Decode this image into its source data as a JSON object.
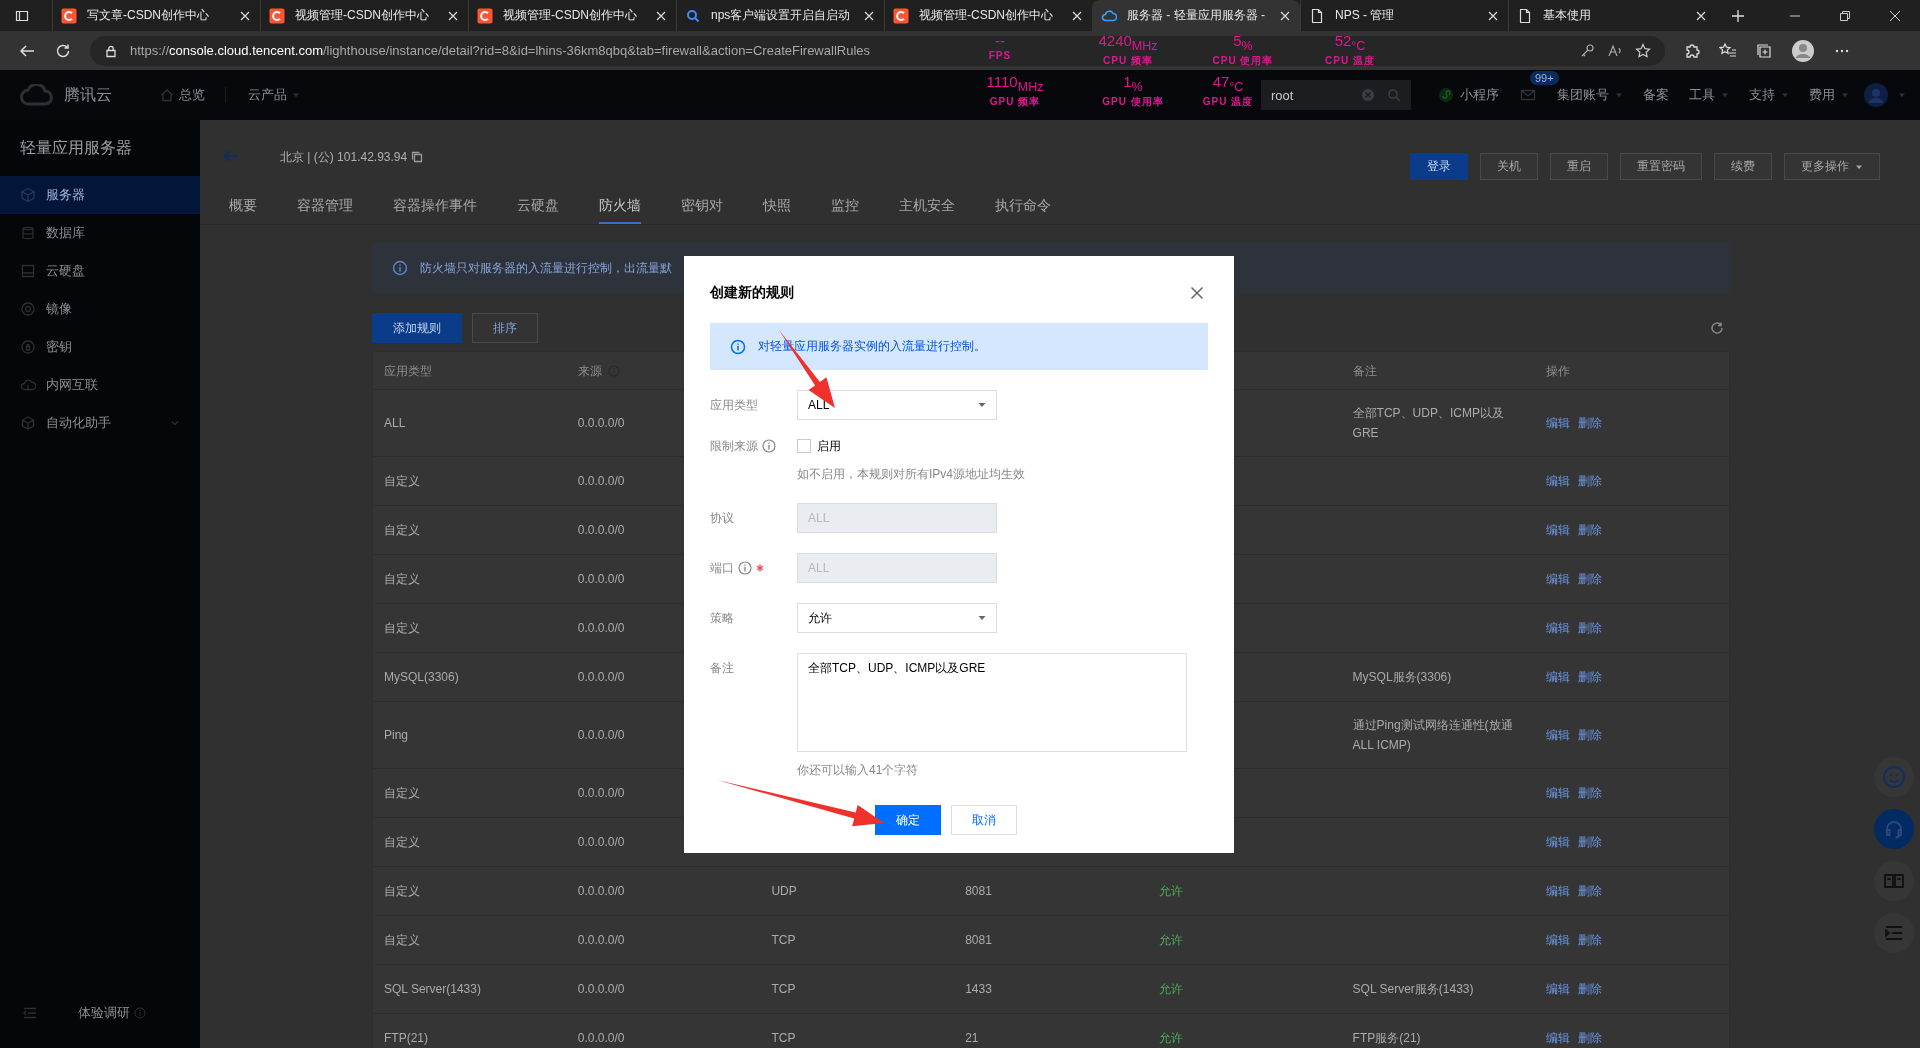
{
  "browser": {
    "tabs": [
      {
        "title": "写文章-CSDN创作中心",
        "kind": "site",
        "selected": false
      },
      {
        "title": "视频管理-CSDN创作中心",
        "kind": "site",
        "selected": false
      },
      {
        "title": "视频管理-CSDN创作中心",
        "kind": "site",
        "selected": false
      },
      {
        "title": "nps客户端设置开启自启动",
        "kind": "search",
        "selected": false
      },
      {
        "title": "视频管理-CSDN创作中心",
        "kind": "site",
        "selected": false
      },
      {
        "title": "服务器 - 轻量应用服务器 -",
        "kind": "cloud",
        "selected": true
      },
      {
        "title": "NPS - 管理",
        "kind": "page",
        "selected": false
      },
      {
        "title": "基本使用",
        "kind": "page",
        "selected": false
      }
    ],
    "address": {
      "scheme": "https://",
      "host": "console.cloud.tencent.com",
      "path": "/lighthouse/instance/detail?rid=8&id=lhins-36km8qbq&tab=firewall&action=CreateFirewallRules"
    }
  },
  "hardware_monitor": [
    {
      "value": "--",
      "label": "FPS"
    },
    {
      "value": "4240$_{MHz}$",
      "label": "CPU 频率"
    },
    {
      "value": "5$_{%}$",
      "label": "CPU 使用率"
    },
    {
      "value": "52$_{°C}$",
      "label": "CPU 温度"
    },
    {
      "value": "1110$_{MHz}$",
      "label": "GPU 频率"
    },
    {
      "value": "1$_{%}$",
      "label": "GPU 使用率"
    },
    {
      "value": "47$_{°C}$",
      "label": "GPU 温度"
    }
  ],
  "header": {
    "brand": "腾讯云",
    "nav": [
      {
        "label": "总览",
        "dropdown": false
      },
      {
        "label": "云产品",
        "dropdown": true
      }
    ],
    "search": {
      "value": "root"
    },
    "mail_badge": "99+",
    "links": [
      {
        "label": "小程序",
        "dropdown": false
      },
      {
        "label": "集团账号",
        "dropdown": true
      },
      {
        "label": "备案",
        "dropdown": false
      },
      {
        "label": "工具",
        "dropdown": true
      },
      {
        "label": "支持",
        "dropdown": true
      },
      {
        "label": "费用",
        "dropdown": true
      }
    ]
  },
  "sidebar": {
    "title": "轻量应用服务器",
    "items": [
      {
        "label": "服务器",
        "selected": true
      },
      {
        "label": "数据库",
        "selected": false
      },
      {
        "label": "云硬盘",
        "selected": false
      },
      {
        "label": "镜像",
        "selected": false
      },
      {
        "label": "密钥",
        "selected": false
      },
      {
        "label": "内网互联",
        "selected": false
      },
      {
        "label": "自动化助手",
        "selected": false,
        "expanded": false
      }
    ],
    "footer": "体验调研"
  },
  "instance": {
    "location": "北京 | (公) 101.42.93.94",
    "actions": [
      {
        "label": "登录",
        "primary": true,
        "dropdown": false
      },
      {
        "label": "关机",
        "primary": false,
        "dropdown": false
      },
      {
        "label": "重启",
        "primary": false,
        "dropdown": false
      },
      {
        "label": "重置密码",
        "primary": false,
        "dropdown": false
      },
      {
        "label": "续费",
        "primary": false,
        "dropdown": false
      },
      {
        "label": "更多操作",
        "primary": false,
        "dropdown": true
      }
    ],
    "tabs": [
      {
        "label": "概要",
        "selected": false
      },
      {
        "label": "容器管理",
        "selected": false
      },
      {
        "label": "容器操作事件",
        "selected": false
      },
      {
        "label": "云硬盘",
        "selected": false
      },
      {
        "label": "防火墙",
        "selected": true
      },
      {
        "label": "密钥对",
        "selected": false
      },
      {
        "label": "快照",
        "selected": false
      },
      {
        "label": "监控",
        "selected": false
      },
      {
        "label": "主机安全",
        "selected": false
      },
      {
        "label": "执行命令",
        "selected": false
      }
    ]
  },
  "firewall": {
    "notice": "防火墙只对服务器的入流量进行控制，出流量默",
    "toolbar": [
      {
        "label": "添加规则",
        "primary": true
      },
      {
        "label": "排序",
        "primary": false
      }
    ],
    "table": {
      "columns": {
        "type": "应用类型",
        "source": "来源",
        "note": "备注",
        "actions": "操作"
      },
      "rows": [
        {
          "type": "ALL",
          "source": "0.0.0.0/0",
          "note": "全部TCP、UDP、ICMP以及GRE",
          "actions": [
            "编辑",
            "删除"
          ]
        },
        {
          "type": "自定义",
          "source": "0.0.0.0/0",
          "actions": [
            "编辑",
            "删除"
          ]
        },
        {
          "type": "自定义",
          "source": "0.0.0.0/0",
          "actions": [
            "编辑",
            "删除"
          ]
        },
        {
          "type": "自定义",
          "source": "0.0.0.0/0",
          "actions": [
            "编辑",
            "删除"
          ]
        },
        {
          "type": "自定义",
          "source": "0.0.0.0/0",
          "actions": [
            "编辑",
            "删除"
          ]
        },
        {
          "type": "MySQL(3306)",
          "source": "0.0.0.0/0",
          "note": "MySQL服务(3306)",
          "actions": [
            "编辑",
            "删除"
          ]
        },
        {
          "type": "Ping",
          "source": "0.0.0.0/0",
          "note": "通过Ping测试网络连通性(放通ALL ICMP)",
          "actions": [
            "编辑",
            "删除"
          ]
        },
        {
          "type": "自定义",
          "source": "0.0.0.0/0",
          "actions": [
            "编辑",
            "删除"
          ]
        },
        {
          "type": "自定义",
          "source": "0.0.0.0/0",
          "actions": [
            "编辑",
            "删除"
          ]
        },
        {
          "type": "自定义",
          "source": "0.0.0.0/0",
          "protocol": "UDP",
          "port": "8081",
          "policy": "允许",
          "actions": [
            "编辑",
            "删除"
          ]
        },
        {
          "type": "自定义",
          "source": "0.0.0.0/0",
          "protocol": "TCP",
          "port": "8081",
          "policy": "允许",
          "actions": [
            "编辑",
            "删除"
          ]
        },
        {
          "type": "SQL Server(1433)",
          "source": "0.0.0.0/0",
          "protocol": "TCP",
          "port": "1433",
          "policy": "允许",
          "note": "SQL Server服务(1433)",
          "actions": [
            "编辑",
            "删除"
          ]
        },
        {
          "type": "FTP(21)",
          "source": "0.0.0.0/0",
          "protocol": "TCP",
          "port": "21",
          "policy": "允许",
          "note": "FTP服务(21)",
          "actions": [
            "编辑",
            "删除"
          ]
        }
      ]
    }
  },
  "modal": {
    "title": "创建新的规则",
    "info": "对轻量应用服务器实例的入流量进行控制。",
    "fields": [
      {
        "label": "应用类型",
        "kind": "select",
        "value": "ALL",
        "info": false,
        "required": false,
        "disabled": false
      },
      {
        "label": "限制来源",
        "kind": "checkbox",
        "option": "启用",
        "checked": false,
        "info": true,
        "required": false,
        "hint": "如不启用，本规则对所有IPv4源地址均生效"
      },
      {
        "label": "协议",
        "kind": "input",
        "value": "ALL",
        "info": false,
        "required": false,
        "disabled": true
      },
      {
        "label": "端口",
        "kind": "input",
        "value": "ALL",
        "info": true,
        "required": true,
        "disabled": true
      },
      {
        "label": "策略",
        "kind": "select",
        "value": "允许",
        "info": false,
        "required": false,
        "disabled": false
      },
      {
        "label": "备注",
        "kind": "textarea",
        "value": "全部TCP、UDP、ICMP以及GRE",
        "info": false,
        "required": false,
        "hint": "你还可以输入41个字符"
      }
    ],
    "buttons": [
      {
        "label": "确定",
        "primary": true
      },
      {
        "label": "取消",
        "primary": false
      }
    ]
  }
}
